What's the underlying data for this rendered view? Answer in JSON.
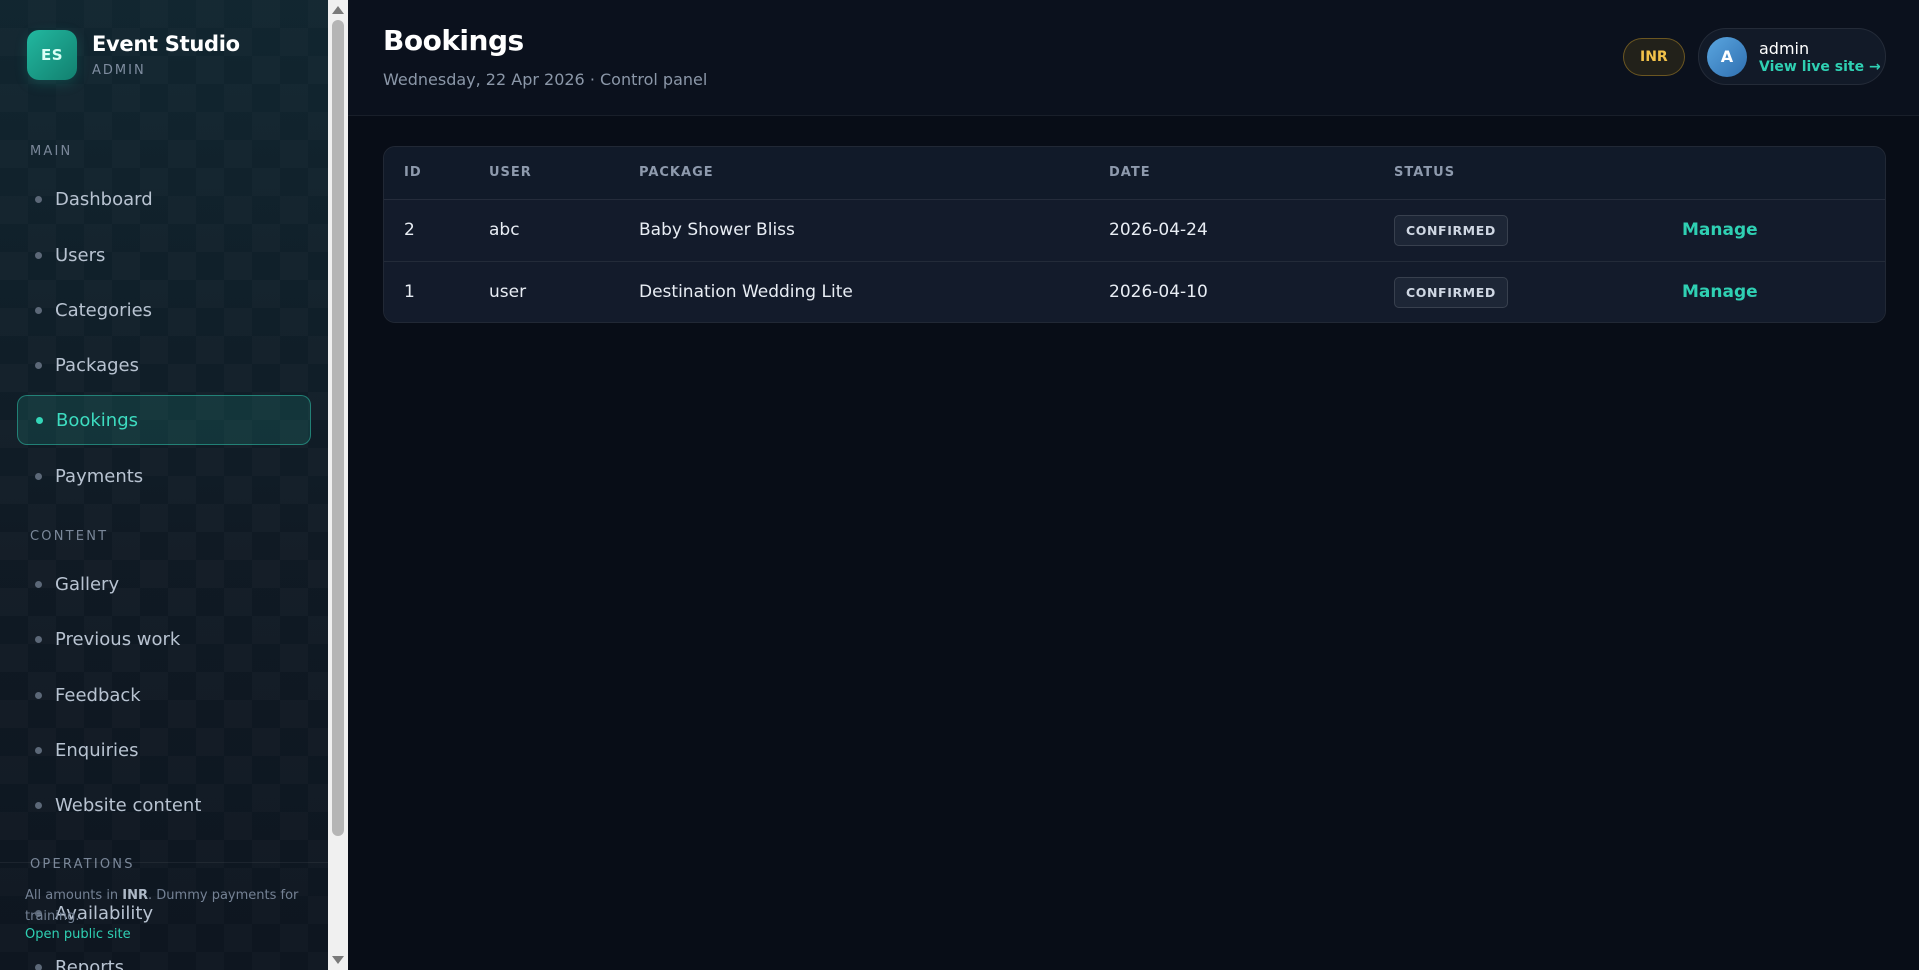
{
  "brand": {
    "logo": "ES",
    "name": "Event Studio",
    "subtitle": "ADMIN"
  },
  "sidebar": {
    "sections": [
      "MAIN",
      "CONTENT",
      "OPERATIONS"
    ],
    "items": [
      {
        "label": "Dashboard"
      },
      {
        "label": "Users"
      },
      {
        "label": "Categories"
      },
      {
        "label": "Packages"
      },
      {
        "label": "Bookings"
      },
      {
        "label": "Payments"
      },
      {
        "label": "Gallery"
      },
      {
        "label": "Previous work"
      },
      {
        "label": "Feedback"
      },
      {
        "label": "Enquiries"
      },
      {
        "label": "Website content"
      },
      {
        "label": "Availability"
      },
      {
        "label": "Reports"
      }
    ],
    "active": "Bookings",
    "footer": {
      "note_prefix": "All amounts in ",
      "note_currency": "INR",
      "note_suffix": ". Dummy payments for training.",
      "link": "Open public site"
    }
  },
  "header": {
    "title": "Bookings",
    "subtitle": "Wednesday, 22 Apr 2026 · Control panel",
    "currency": "INR",
    "user": {
      "avatar": "A",
      "name": "admin",
      "link": "View live site →"
    }
  },
  "table": {
    "columns": [
      "ID",
      "USER",
      "PACKAGE",
      "DATE",
      "STATUS",
      ""
    ],
    "rows": [
      {
        "id": "2",
        "user": "abc",
        "package": "Baby Shower Bliss",
        "date": "2026-04-24",
        "status": "CONFIRMED",
        "action": "Manage"
      },
      {
        "id": "1",
        "user": "user",
        "package": "Destination Wedding Lite",
        "date": "2026-04-10",
        "status": "CONFIRMED",
        "action": "Manage"
      }
    ]
  },
  "colors": {
    "accent": "#2fd0b3",
    "currency_badge": "#f2c24a",
    "background": "#080d17"
  }
}
